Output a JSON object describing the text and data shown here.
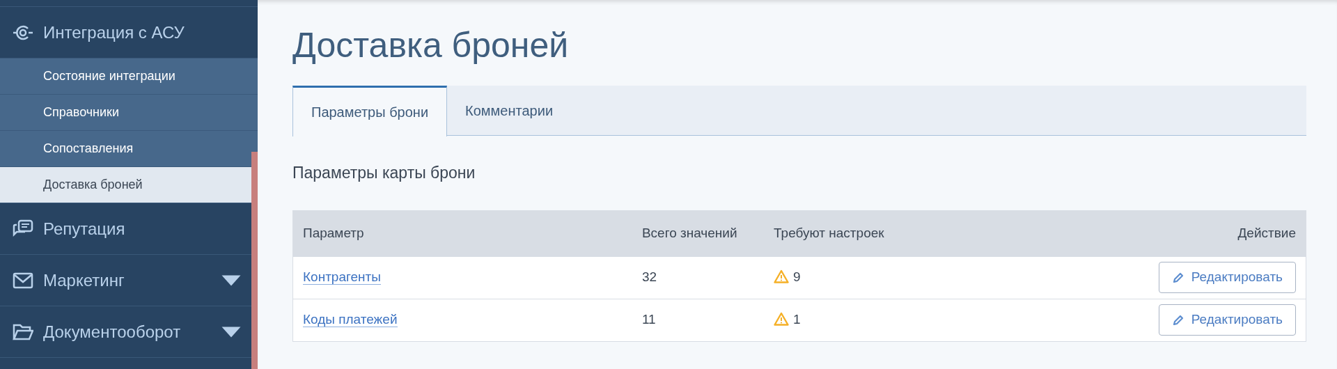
{
  "sidebar": {
    "items": [
      {
        "label": "Интеграция с АСУ",
        "expandable": false,
        "children": [
          {
            "label": "Состояние интеграции",
            "selected": false
          },
          {
            "label": "Справочники",
            "selected": false
          },
          {
            "label": "Сопоставления",
            "selected": false
          },
          {
            "label": "Доставка броней",
            "selected": true
          }
        ]
      },
      {
        "label": "Репутация",
        "expandable": false
      },
      {
        "label": "Маркетинг",
        "expandable": true
      },
      {
        "label": "Документооборот",
        "expandable": true
      }
    ]
  },
  "page": {
    "title": "Доставка броней",
    "tabs": [
      {
        "label": "Параметры брони",
        "selected": true
      },
      {
        "label": "Комментарии",
        "selected": false
      }
    ],
    "section_title": "Параметры карты брони",
    "table": {
      "columns": [
        "Параметр",
        "Всего значений",
        "Требуют настроек",
        "Действие"
      ],
      "rows": [
        {
          "parameter": "Контрагенты",
          "total": "32",
          "pending": "9",
          "action": "Редактировать"
        },
        {
          "parameter": "Коды платежей",
          "total": "11",
          "pending": "1",
          "action": "Редактировать"
        }
      ]
    }
  }
}
